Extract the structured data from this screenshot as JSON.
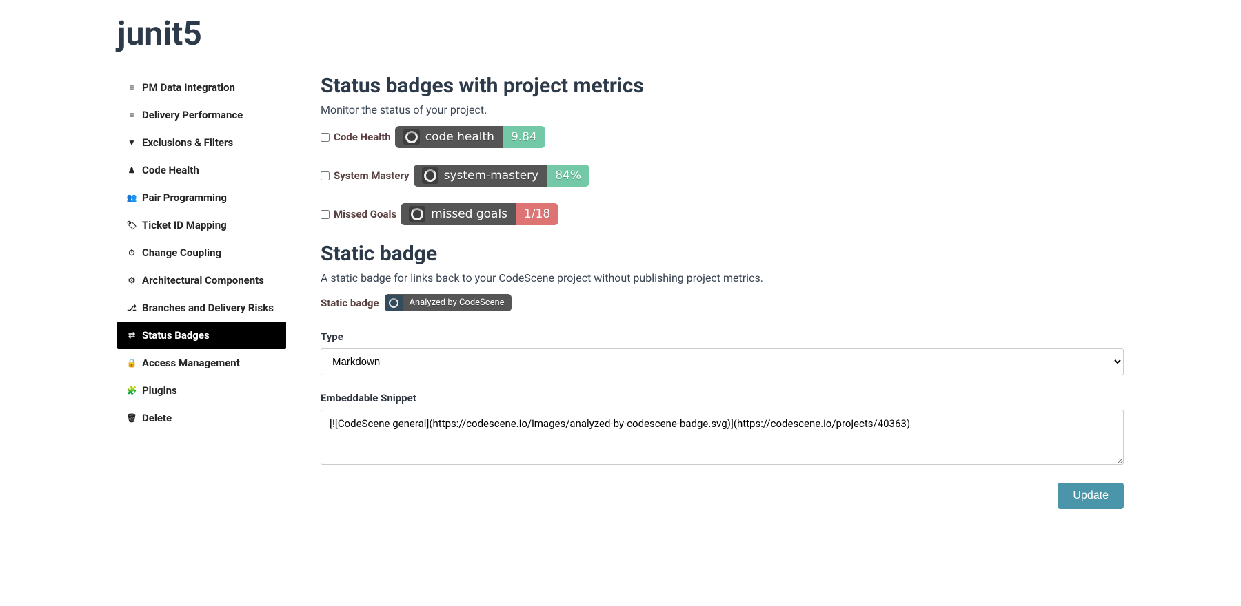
{
  "header": {
    "title": "junit5"
  },
  "sidebar": {
    "items": [
      {
        "icon": "≡",
        "label": "PM Data Integration"
      },
      {
        "icon": "≡",
        "label": "Delivery Performance"
      },
      {
        "icon": "▼",
        "label": "Exclusions & Filters"
      },
      {
        "icon": "♟",
        "label": "Code Health"
      },
      {
        "icon": "👥",
        "label": "Pair Programming"
      },
      {
        "icon": "🏷",
        "label": "Ticket ID Mapping"
      },
      {
        "icon": "⏱",
        "label": "Change Coupling"
      },
      {
        "icon": "⚙",
        "label": "Architectural Components"
      },
      {
        "icon": "⎇",
        "label": "Branches and Delivery Risks"
      },
      {
        "icon": "⇄",
        "label": "Status Badges"
      },
      {
        "icon": "🔒",
        "label": "Access Management"
      },
      {
        "icon": "🧩",
        "label": "Plugins"
      },
      {
        "icon": "🗑",
        "label": "Delete"
      }
    ],
    "active_index": 9
  },
  "sections": {
    "metrics": {
      "title": "Status badges with project metrics",
      "desc": "Monitor the status of your project.",
      "rows": [
        {
          "label": "Code Health",
          "badge_label": "code health",
          "value": "9.84",
          "value_color": "green"
        },
        {
          "label": "System Mastery",
          "badge_label": "system-mastery",
          "value": "84%",
          "value_color": "green"
        },
        {
          "label": "Missed Goals",
          "badge_label": "missed goals",
          "value": "1/18",
          "value_color": "red"
        }
      ]
    },
    "static": {
      "title": "Static badge",
      "desc": "A static badge for links back to your CodeScene project without publishing project metrics.",
      "row_label": "Static badge",
      "badge_text": "Analyzed by CodeScene"
    },
    "form": {
      "type_label": "Type",
      "type_value": "Markdown",
      "snippet_label": "Embeddable Snippet",
      "snippet_value": "[![CodeScene general](https://codescene.io/images/analyzed-by-codescene-badge.svg)](https://codescene.io/projects/40363)",
      "update_label": "Update"
    }
  }
}
